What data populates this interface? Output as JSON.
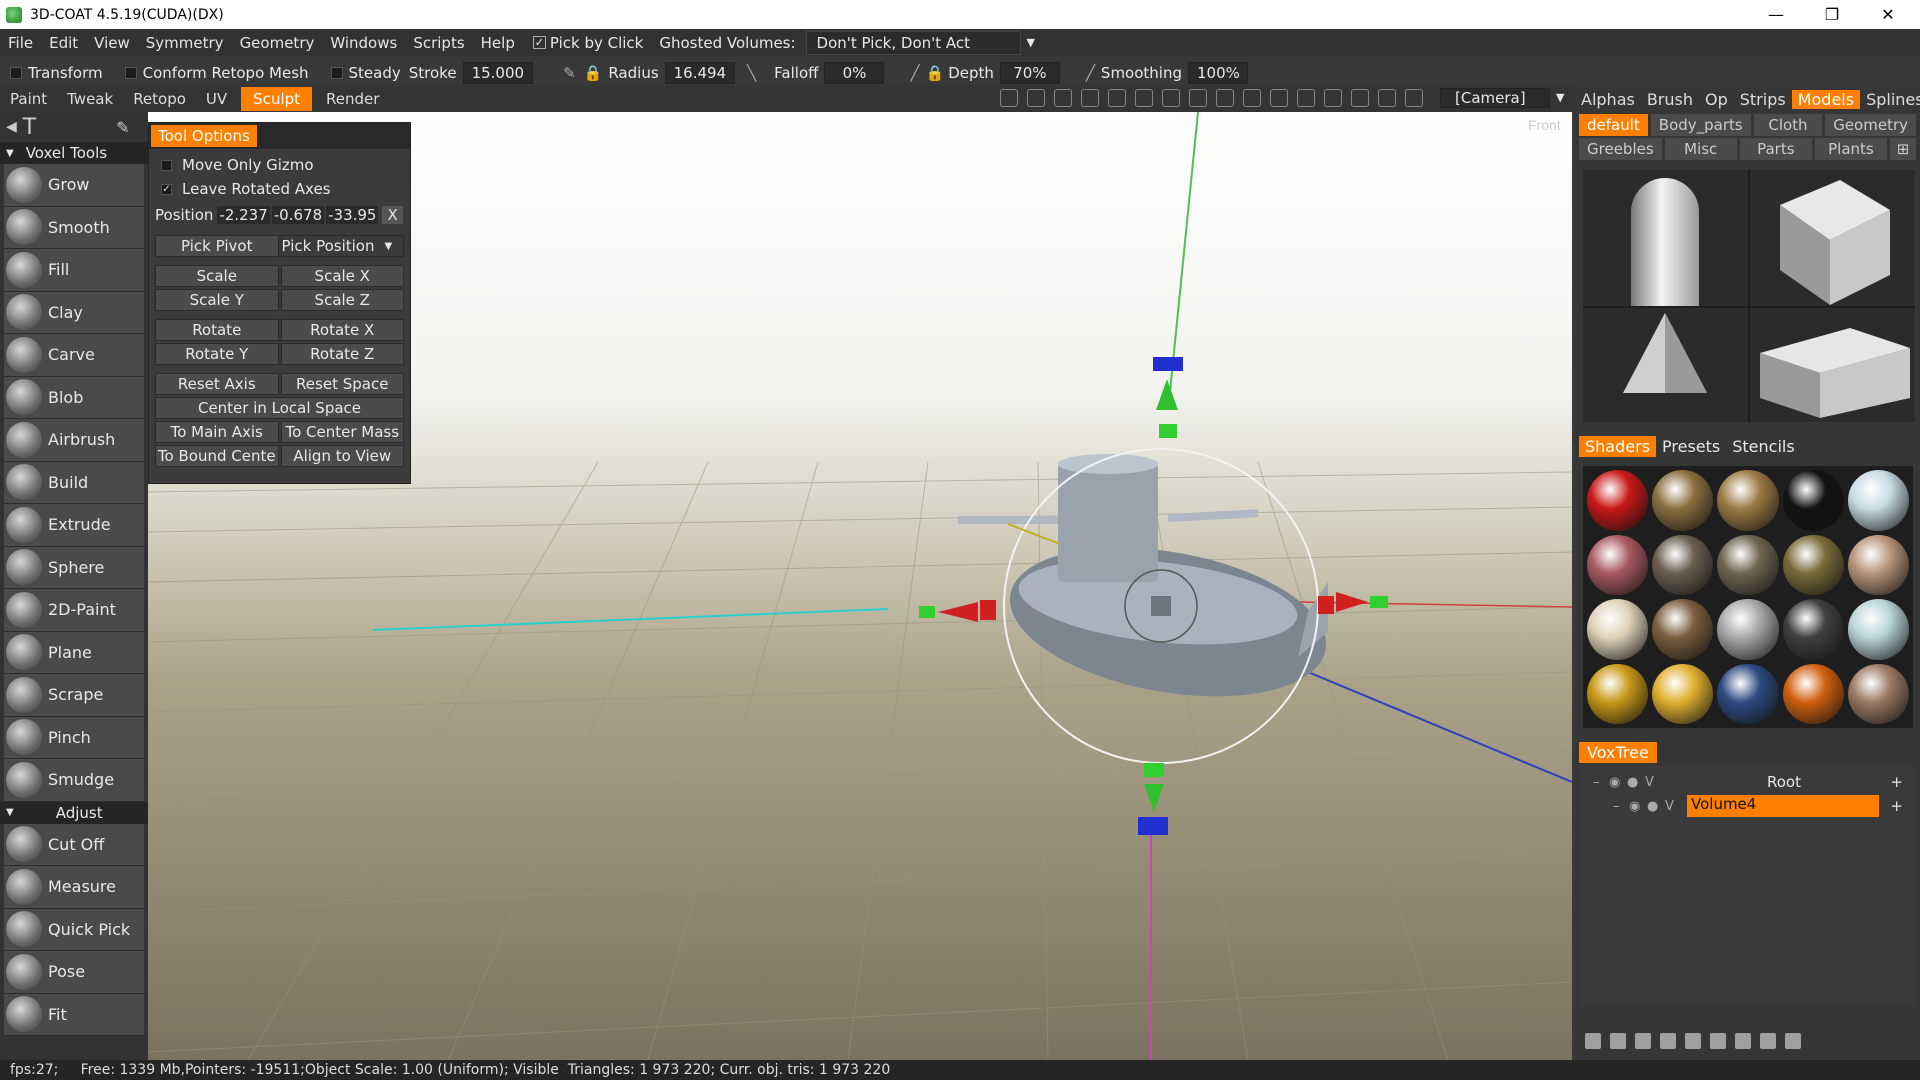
{
  "app": {
    "title": "3D-COAT 4.5.19(CUDA)(DX)"
  },
  "menu": {
    "items": [
      "File",
      "Edit",
      "View",
      "Symmetry",
      "Geometry",
      "Windows",
      "Scripts",
      "Help"
    ],
    "pick_by_click": "Pick by Click",
    "ghosted_label": "Ghosted Volumes:",
    "ghosted_value": "Don't Pick, Don't Act"
  },
  "toolbar": {
    "transform": "Transform",
    "conform": "Conform Retopo Mesh",
    "steady_label": "Steady",
    "stroke_label": "Stroke",
    "stroke_value": "15.000",
    "radius_label": "Radius",
    "radius_value": "16.494",
    "falloff_label": "Falloff",
    "falloff_value": "0%",
    "depth_label": "Depth",
    "depth_value": "70%",
    "smoothing_label": "Smoothing",
    "smoothing_value": "100%"
  },
  "rooms": [
    "Paint",
    "Tweak",
    "Retopo",
    "UV",
    "Sculpt",
    "Render"
  ],
  "active_room": "Sculpt",
  "camera": "[Camera]",
  "viewport_label": "Front",
  "left": {
    "section1": "Voxel Tools",
    "tools": [
      "Grow",
      "Smooth",
      "Fill",
      "Clay",
      "Carve",
      "Blob",
      "Airbrush",
      "Build",
      "Extrude",
      "Sphere",
      "2D-Paint",
      "Plane",
      "Scrape",
      "Pinch",
      "Smudge"
    ],
    "section2": "Adjust",
    "adjust": [
      "Cut Off",
      "Measure",
      "Quick Pick",
      "Pose",
      "Fit"
    ]
  },
  "tool_options": {
    "title": "Tool Options",
    "move_only_gizmo": "Move Only Gizmo",
    "leave_rotated_axes": "Leave Rotated Axes",
    "position_label": "Position",
    "pos_x": "-2.237",
    "pos_y": "-0.678",
    "pos_z": "-33.95",
    "pos_reset": "X",
    "pick_pivot": "Pick Pivot",
    "pick_position": "Pick Position",
    "scale": "Scale",
    "scale_x": "Scale X",
    "scale_y": "Scale Y",
    "scale_z": "Scale Z",
    "rotate": "Rotate",
    "rotate_x": "Rotate X",
    "rotate_y": "Rotate Y",
    "rotate_z": "Rotate Z",
    "reset_axis": "Reset Axis",
    "reset_space": "Reset Space",
    "center_local": "Center in Local Space",
    "to_main_axis": "To Main Axis",
    "to_center_mass": "To Center Mass",
    "to_bound_center": "To Bound Cente",
    "align_to_view": "Align to View"
  },
  "right": {
    "tabs": [
      "Alphas",
      "Brush",
      "Op",
      "Strips",
      "Models",
      "Splines"
    ],
    "active_tab": "Models",
    "sub1": [
      "default",
      "Body_parts",
      "Cloth",
      "Geometry"
    ],
    "sub2": [
      "Greebles",
      "Misc",
      "Parts",
      "Plants"
    ],
    "shader_tabs": [
      "Shaders",
      "Presets",
      "Stencils"
    ],
    "voxtree_tab": "VoxTree",
    "root": "Root",
    "volume": "Volume4",
    "vis_char": "V"
  },
  "shader_colors": [
    [
      "#c81818",
      "#8c6f40",
      "#9c7a44",
      "#121212",
      "#c7dce4"
    ],
    [
      "#a85a60",
      "#6a5e4e",
      "#6f6650",
      "#7a6b3a",
      "#b8957a"
    ],
    [
      "#e0d2b8",
      "#7a5e3e",
      "#a8a8a8",
      "#3f3f3f",
      "#b8d4d8"
    ],
    [
      "#c79818",
      "#e0b030",
      "#2e4a80",
      "#d06010",
      "#9a7a64"
    ]
  ],
  "status": "fps:27;     Free: 1339 Mb,Pointers: -19511;Object Scale: 1.00 (Uniform); Visible  Triangles: 1 973 220; Curr. obj. tris: 1 973 220"
}
